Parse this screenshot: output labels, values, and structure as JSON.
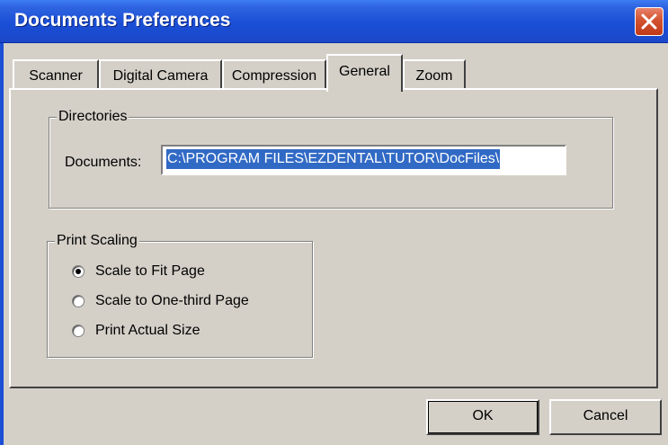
{
  "window": {
    "title": "Documents Preferences"
  },
  "tabs": [
    {
      "label": "Scanner"
    },
    {
      "label": "Digital Camera"
    },
    {
      "label": "Compression"
    },
    {
      "label": "General"
    },
    {
      "label": "Zoom"
    }
  ],
  "active_tab": "General",
  "directories": {
    "group_label": "Directories",
    "documents_label": "Documents:",
    "documents_value": "C:\\PROGRAM FILES\\EZDENTAL\\TUTOR\\DocFiles\\"
  },
  "print_scaling": {
    "group_label": "Print Scaling",
    "options": [
      {
        "label": "Scale to Fit Page",
        "selected": true
      },
      {
        "label": "Scale to One-third Page",
        "selected": false
      },
      {
        "label": "Print Actual Size",
        "selected": false
      }
    ]
  },
  "buttons": {
    "ok": "OK",
    "cancel": "Cancel"
  },
  "icons": {
    "close": "close-icon",
    "radio_selected": "radio-selected-icon",
    "radio_empty": "radio-empty-icon"
  },
  "colors": {
    "titlebar": "#1a4fd6",
    "selection": "#316ac5",
    "close_button": "#d2522f",
    "face": "#d4d0c8"
  }
}
